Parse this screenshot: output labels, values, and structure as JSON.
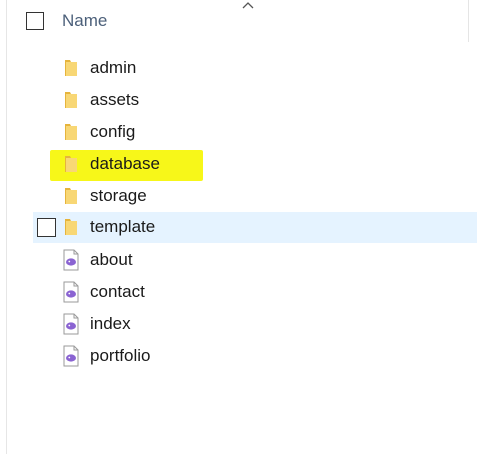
{
  "header": {
    "name_label": "Name"
  },
  "items": [
    {
      "label": "admin",
      "type": "folder"
    },
    {
      "label": "assets",
      "type": "folder"
    },
    {
      "label": "config",
      "type": "folder"
    },
    {
      "label": "database",
      "type": "folder",
      "highlighted": true
    },
    {
      "label": "storage",
      "type": "folder"
    },
    {
      "label": "template",
      "type": "folder",
      "hovered": true
    },
    {
      "label": "about",
      "type": "php-file"
    },
    {
      "label": "contact",
      "type": "php-file"
    },
    {
      "label": "index",
      "type": "php-file"
    },
    {
      "label": "portfolio",
      "type": "php-file"
    }
  ],
  "colors": {
    "folder": "#f8d775",
    "folder_dark": "#e6b43c",
    "php_badge": "#8a63d2",
    "hover_bg": "#e5f3ff",
    "highlight": "#f6f600"
  }
}
